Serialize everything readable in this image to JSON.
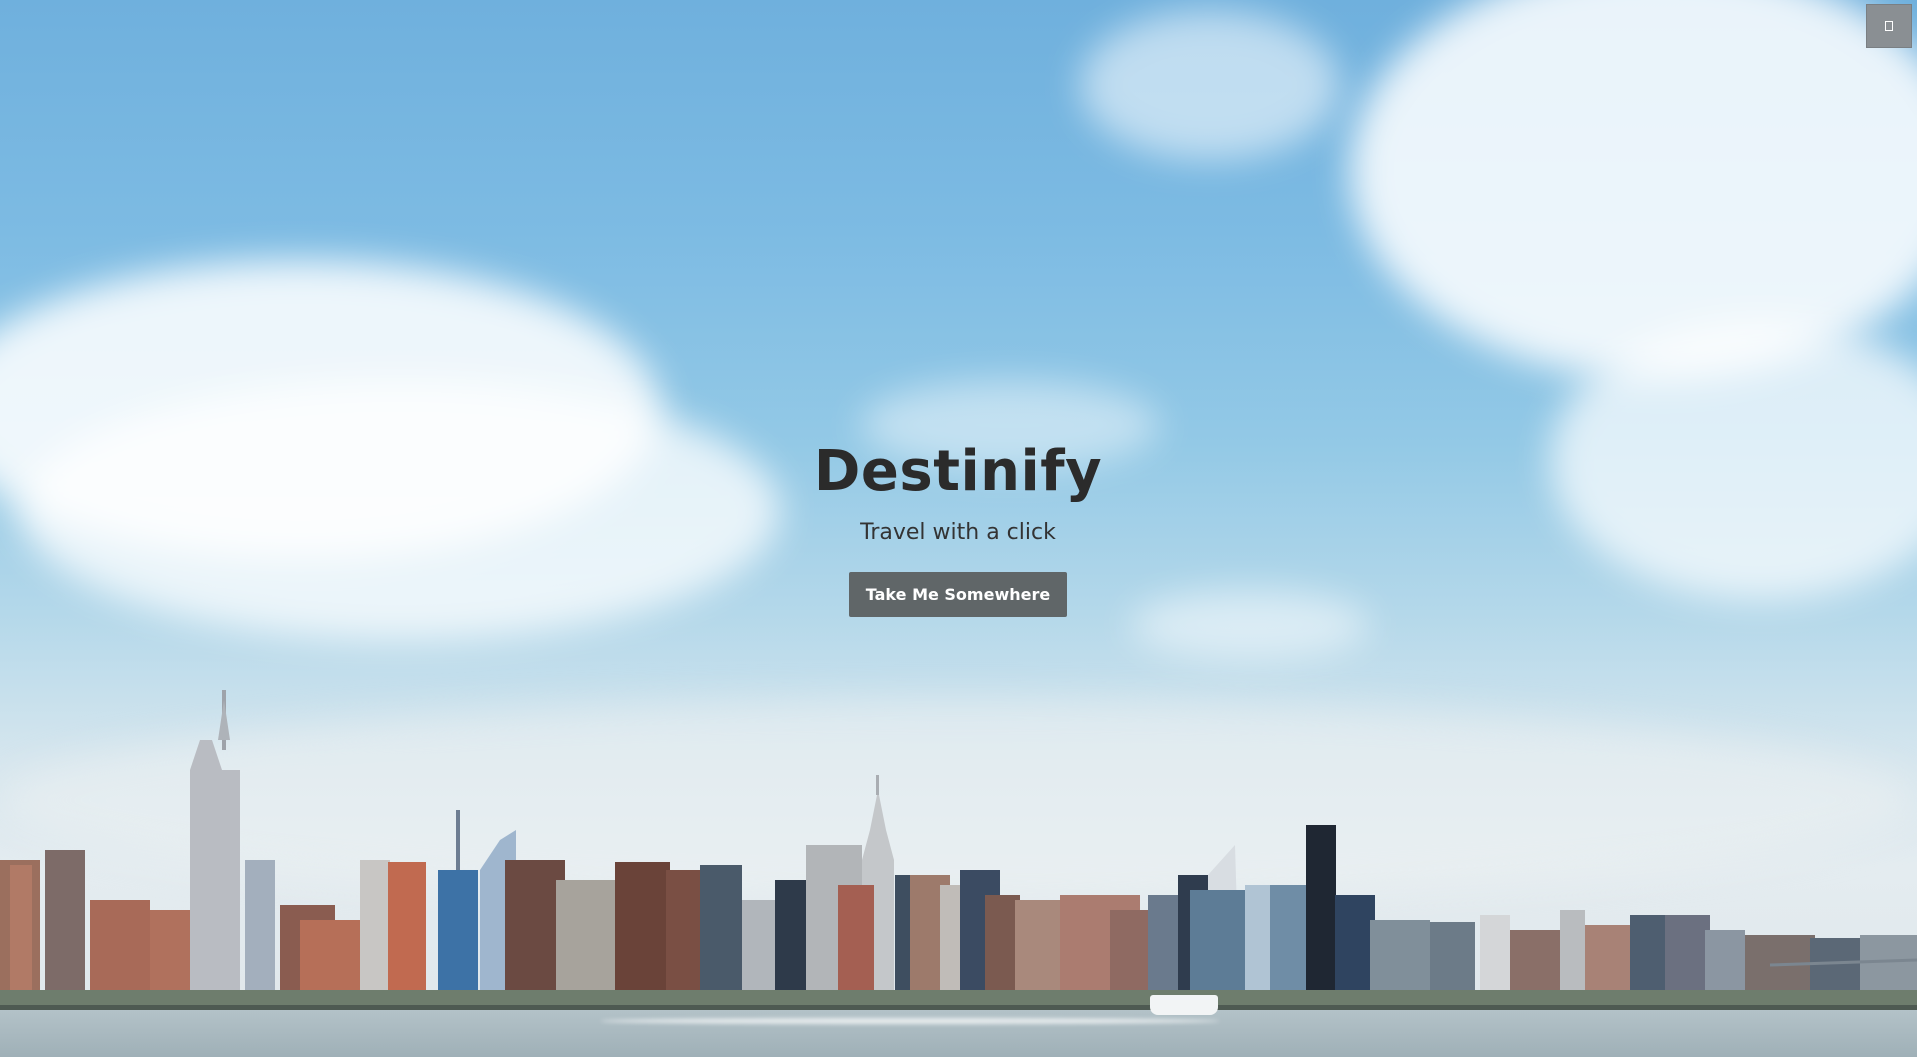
{
  "hero": {
    "title": "Destinify",
    "subtitle": "Travel with a click",
    "cta_label": "Take Me Somewhere",
    "background": "city-skyline-photo"
  },
  "corner_button": {
    "icon": "box-icon"
  },
  "colors": {
    "title": "#2b2b2b",
    "button_bg": "#606668",
    "button_text": "#ffffff",
    "corner_button_bg": "#8a8f93"
  }
}
